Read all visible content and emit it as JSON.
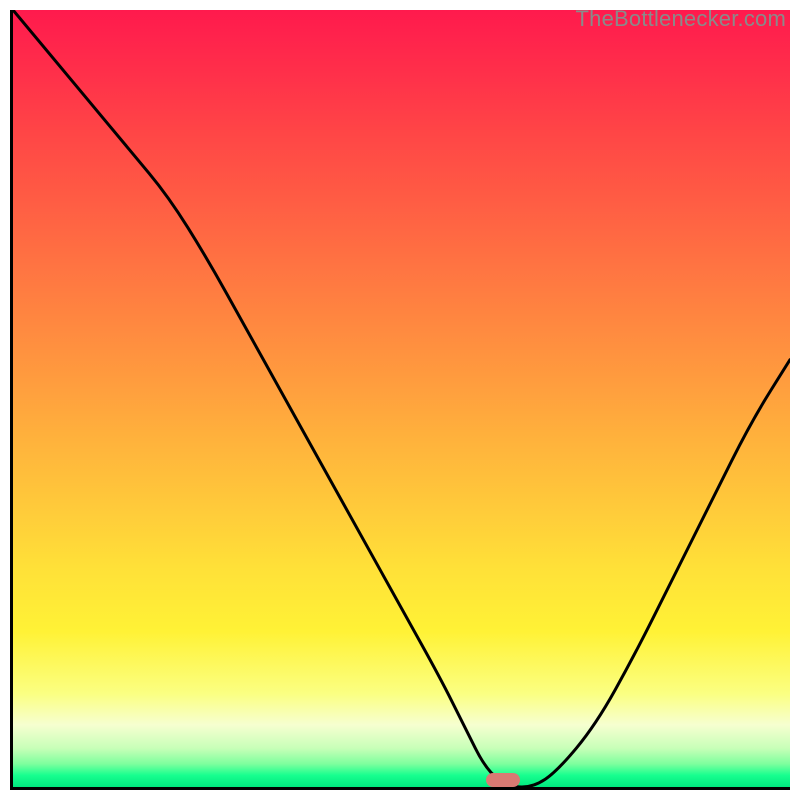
{
  "watermark": {
    "text": "TheBottlenecker.com"
  },
  "marker": {
    "left_pct": 63,
    "top_pct": 99.1,
    "color": "#d97a73"
  },
  "chart_data": {
    "type": "line",
    "title": "",
    "xlabel": "",
    "ylabel": "",
    "xlim": [
      0,
      100
    ],
    "ylim": [
      0,
      100
    ],
    "x": [
      0,
      5,
      10,
      15,
      20,
      25,
      30,
      35,
      40,
      45,
      50,
      55,
      58,
      61,
      64,
      67,
      70,
      75,
      80,
      85,
      90,
      95,
      100
    ],
    "y": [
      100,
      94,
      88,
      82,
      76,
      68,
      59,
      50,
      41,
      32,
      23,
      14,
      8,
      2,
      0,
      0,
      2,
      8,
      17,
      27,
      37,
      47,
      55
    ],
    "notes": "Axes are unlabeled; values estimated as percentage of plot width/height. Curve is a V-shape bottoming near x≈63–66. Background is a vertical heat gradient (red top → green bottom). A small rounded pink marker sits at the curve minimum on the baseline."
  }
}
